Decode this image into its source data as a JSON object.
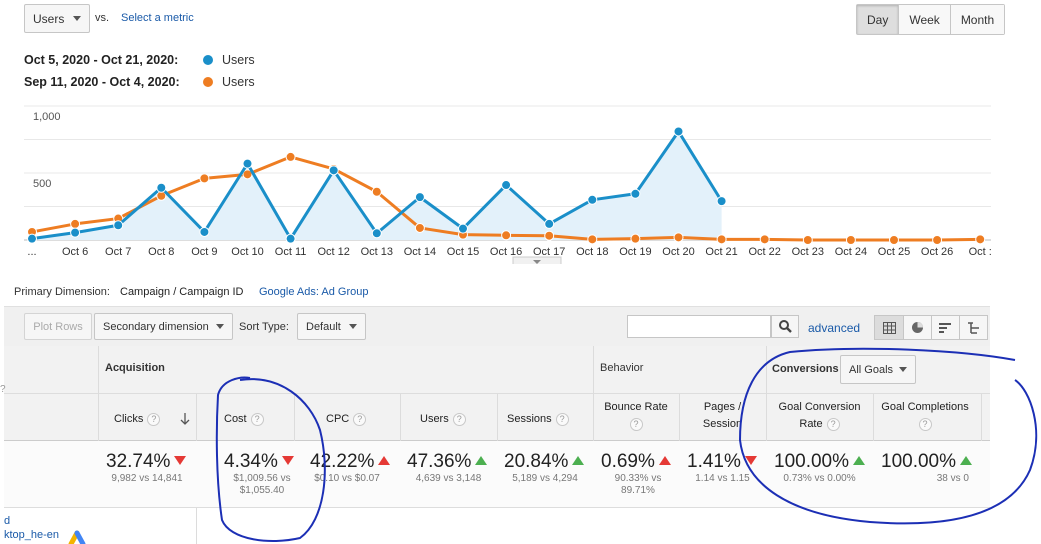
{
  "controls": {
    "metric": "Users",
    "vs": "vs.",
    "select_metric": "Select a metric",
    "periods": [
      "Day",
      "Week",
      "Month"
    ],
    "selected_period": "Day"
  },
  "legend": [
    {
      "range": "Oct 5, 2020 - Oct 21, 2020:",
      "series": "Users",
      "color": "#1a8fc9"
    },
    {
      "range": "Sep 11, 2020 - Oct 4, 2020:",
      "series": "Users",
      "color": "#ee7d22"
    }
  ],
  "chart_data": {
    "type": "line",
    "y_ticks": [
      {
        "value": 1000,
        "label": "1,000"
      },
      {
        "value": 500,
        "label": "500"
      }
    ],
    "ylim": [
      0,
      1000
    ],
    "x_labels": [
      "...",
      "Oct 6",
      "Oct 7",
      "Oct 8",
      "Oct 9",
      "Oct 10",
      "Oct 11",
      "Oct 12",
      "Oct 13",
      "Oct 14",
      "Oct 15",
      "Oct 16",
      "Oct 17",
      "Oct 18",
      "Oct 19",
      "Oct 20",
      "Oct 21",
      "Oct 22",
      "Oct 23",
      "Oct 24",
      "Oct 25",
      "Oct 26",
      "Oct :"
    ],
    "series": [
      {
        "color": "#1a8fc9",
        "fill": "#e3f1fa",
        "values": [
          10,
          55,
          110,
          390,
          60,
          570,
          10,
          520,
          50,
          320,
          85,
          410,
          120,
          300,
          345,
          810,
          290
        ]
      },
      {
        "color": "#ee7d22",
        "values": [
          60,
          120,
          160,
          330,
          460,
          490,
          620,
          530,
          360,
          90,
          40,
          35,
          32,
          5,
          10,
          20,
          5,
          5,
          0,
          0,
          0,
          0,
          5
        ]
      }
    ]
  },
  "primary_dimension": {
    "label": "Primary Dimension:",
    "value": "Campaign / Campaign ID",
    "link": "Google Ads: Ad Group"
  },
  "toolbar": {
    "plot_rows": "Plot Rows",
    "secondary_dimension": "Secondary dimension",
    "sort_label": "Sort Type:",
    "sort_value": "Default",
    "advanced": "advanced"
  },
  "table": {
    "groups": {
      "acquisition": "Acquisition",
      "behavior": "Behavior",
      "conversions": "Conversions",
      "goals_select": "All Goals"
    },
    "columns": [
      {
        "label": "Clicks",
        "pct": "32.74%",
        "dir": "down",
        "cmp": "9,982 vs 14,841"
      },
      {
        "label": "Cost",
        "pct": "4.34%",
        "dir": "down",
        "cmp": "$1,009.56 vs $1,055.40"
      },
      {
        "label": "CPC",
        "pct": "42.22%",
        "dir": "up-red",
        "cmp": "$0.10 vs $0.07"
      },
      {
        "label": "Users",
        "pct": "47.36%",
        "dir": "up",
        "cmp": "4,639 vs 3,148"
      },
      {
        "label": "Sessions",
        "pct": "20.84%",
        "dir": "up",
        "cmp": "5,189 vs 4,294"
      },
      {
        "label": "Bounce Rate",
        "pct": "0.69%",
        "dir": "up-red",
        "cmp": "90.33% vs 89.71%"
      },
      {
        "label": "Pages / Session",
        "pct": "1.41%",
        "dir": "down",
        "cmp": "1.14 vs 1.15"
      },
      {
        "label": "Goal Conversion Rate",
        "pct": "100.00%",
        "dir": "up",
        "cmp": "0.73% vs 0.00%"
      },
      {
        "label": "Goal Completions",
        "pct": "100.00%",
        "dir": "up",
        "cmp": "38 vs 0"
      }
    ],
    "row_label_line1": "d",
    "row_label_line2": "ktop_he-en"
  }
}
